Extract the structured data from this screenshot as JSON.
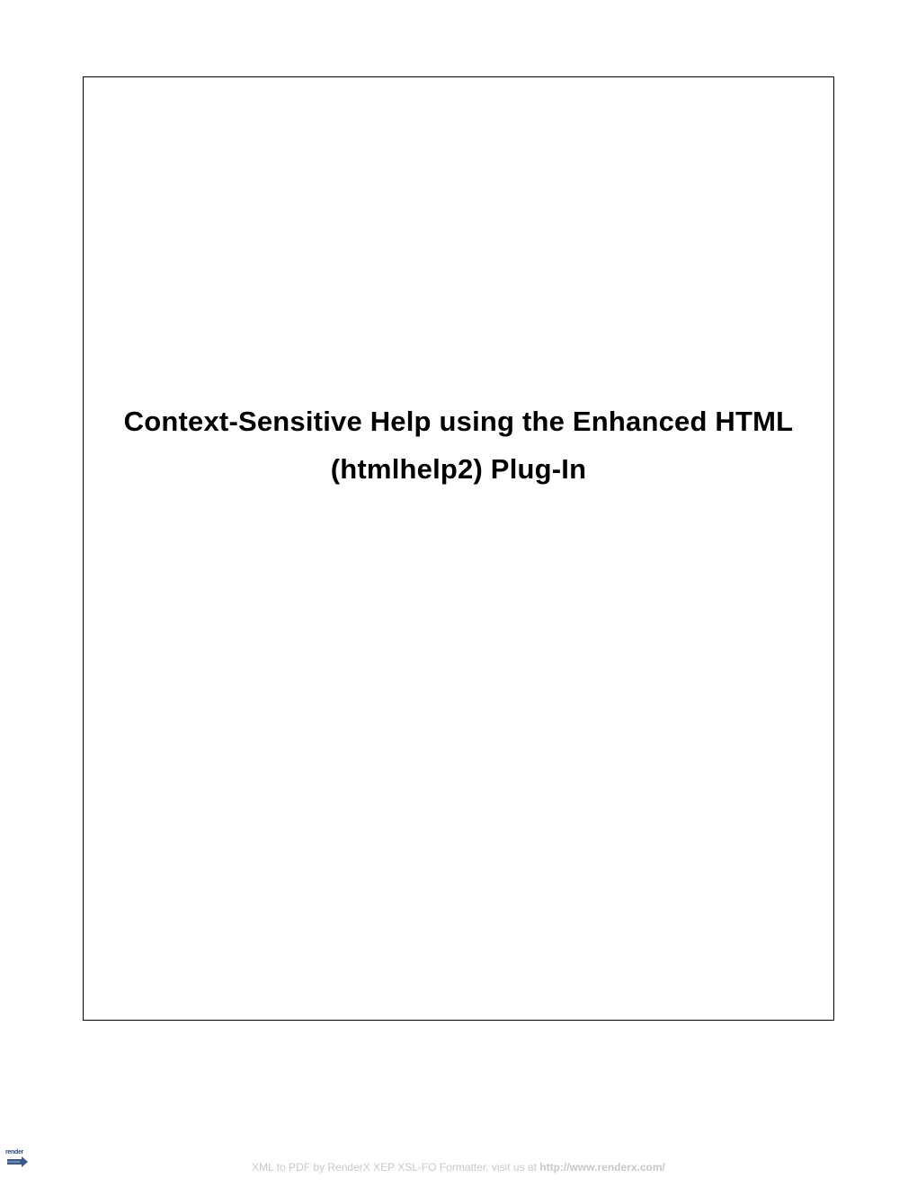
{
  "document": {
    "title_line1": "Context-Sensitive Help using the Enhanced HTML",
    "title_line2": "(htmlhelp2) Plug-In"
  },
  "footer": {
    "text_prefix": "XML to PDF by RenderX XEP XSL-FO Formatter, visit us at ",
    "link_text": "http://www.renderx.com/"
  },
  "logo": {
    "text": "render"
  }
}
